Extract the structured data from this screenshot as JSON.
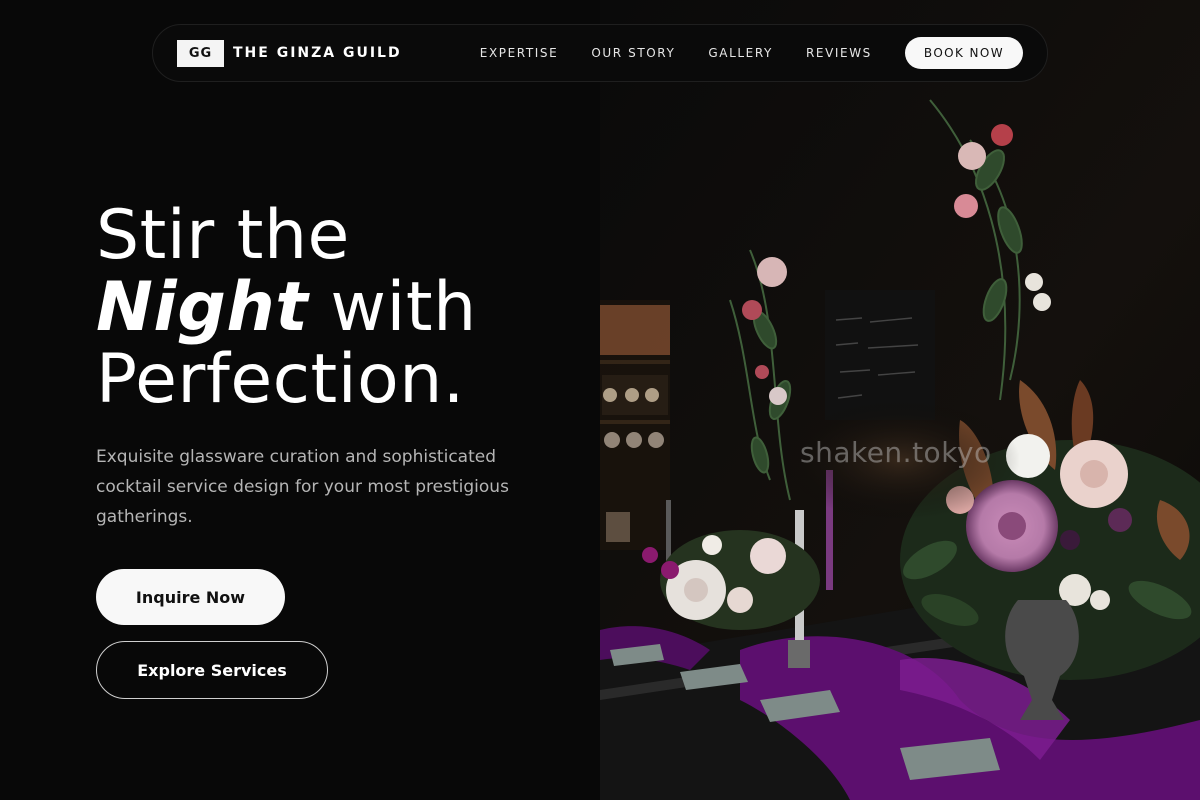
{
  "brand": {
    "mark": "GG",
    "name": "THE GINZA GUILD"
  },
  "nav": {
    "links": [
      "EXPERTISE",
      "OUR STORY",
      "GALLERY",
      "REVIEWS"
    ],
    "cta": "BOOK NOW"
  },
  "hero": {
    "headline_line1": "Stir the",
    "headline_accent": "Night",
    "headline_line2_rest": " with",
    "headline_line3": "Perfection.",
    "subtitle": "Exquisite glassware curation and sophisticated cocktail service design for your most prestigious gatherings.",
    "primary_cta": "Inquire Now",
    "secondary_cta": "Explore Services"
  },
  "image": {
    "watermark": "shaken.tokyo"
  },
  "colors": {
    "background": "#080808",
    "accent_purple": "#5c0f6e",
    "button_light": "#f8f8f8",
    "text_muted": "#b5b5b5"
  }
}
